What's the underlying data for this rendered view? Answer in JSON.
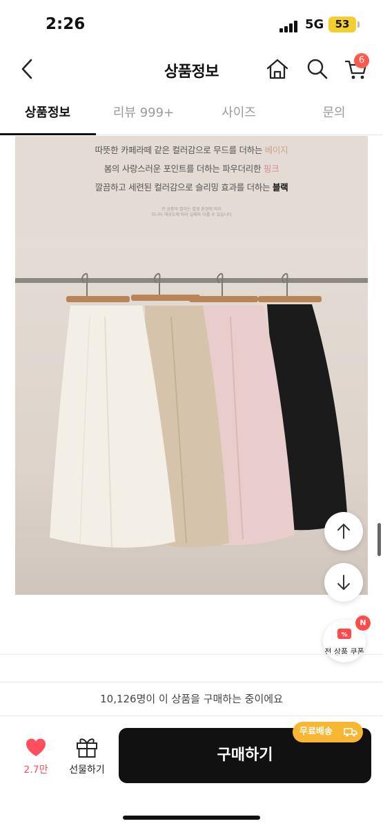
{
  "status_bar": {
    "time": "2:26",
    "network": "5G",
    "battery": "53"
  },
  "header": {
    "title": "상품정보",
    "icons": [
      "back-icon",
      "home-icon",
      "search-icon",
      "cart-icon"
    ],
    "cart_badge": "6"
  },
  "tabs": [
    {
      "label": "상품정보",
      "active": true
    },
    {
      "label": "리뷰 999+",
      "active": false
    },
    {
      "label": "사이즈",
      "active": false
    },
    {
      "label": "문의",
      "active": false
    }
  ],
  "product_image": {
    "captions": [
      {
        "text": "따뜻한 카페라떼 같은 컬러감으로 무드를 더하는 ",
        "accent": "베이지"
      },
      {
        "text": "봄의 사랑스러운 포인트를 더하는 파우더리한 ",
        "accent": "핑크"
      },
      {
        "text": "깔끔하고 세련된 컬러감으로 슬리밍 효과를 더하는 ",
        "accent": "블랙"
      }
    ],
    "fine_print": [
      "전 상품의 컬러는 촬영 환경에 따라",
      "모니터 해상도에 따라 실제와 다를 수 있습니다"
    ],
    "skirt_colors": [
      "#f3efe7",
      "#d6c3ab",
      "#e8cdcc",
      "#1b1b1b"
    ]
  },
  "floating": {
    "scroll_up": "arrow-up-icon",
    "scroll_down": "arrow-down-icon",
    "coupon_label": "전 상품 쿠폰",
    "coupon_badge": "N"
  },
  "bottom_bar": {
    "buyers_text": "10,126명이 이 상품을 구매하는 중이에요",
    "like_count": "2.7만",
    "gift_label": "선물하기",
    "buy_label": "구매하기",
    "free_shipping": "무료배송"
  },
  "colors": {
    "accent_red": "#ff4f5e",
    "badge_red": "#ff5a4e",
    "free_ship_yellow": "#f7b733",
    "buy_button": "#111111"
  }
}
